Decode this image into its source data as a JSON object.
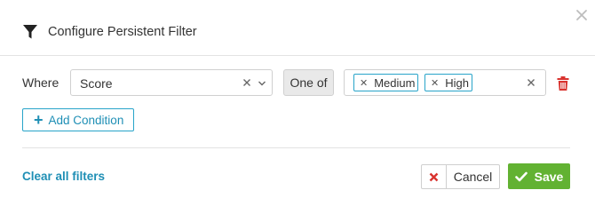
{
  "dialog": {
    "title": "Configure Persistent Filter",
    "title_icon": "funnel-icon",
    "close_icon": "close-icon"
  },
  "condition": {
    "where_label": "Where",
    "field": {
      "value": "Score",
      "clear_icon": "clear-icon",
      "dropdown_icon": "chevron-down-icon"
    },
    "operator": "One of",
    "values": [
      {
        "label": "Medium"
      },
      {
        "label": "High"
      }
    ],
    "values_clear_icon": "clear-icon",
    "delete_icon": "trash-icon"
  },
  "actions": {
    "add_condition": "Add Condition",
    "clear_all": "Clear all filters",
    "cancel": "Cancel",
    "save": "Save"
  },
  "colors": {
    "accent": "#1f8fb5",
    "save_green": "#62b232",
    "delete_red": "#d9332f"
  }
}
